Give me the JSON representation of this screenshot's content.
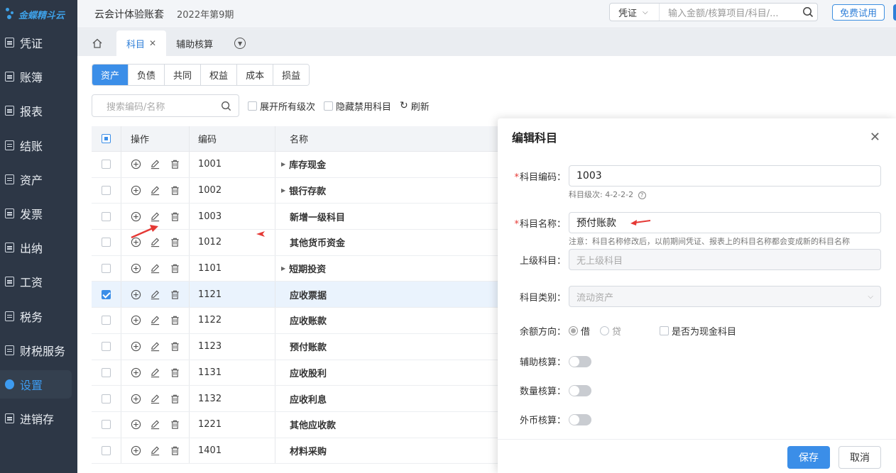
{
  "brand": {
    "name": "金蝶精斗云"
  },
  "sidebar": {
    "items": [
      {
        "label": "凭证",
        "icon": "voucher-icon"
      },
      {
        "label": "账簿",
        "icon": "ledger-icon"
      },
      {
        "label": "报表",
        "icon": "report-icon"
      },
      {
        "label": "结账",
        "icon": "closing-icon"
      },
      {
        "label": "资产",
        "icon": "asset-icon"
      },
      {
        "label": "发票",
        "icon": "invoice-icon"
      },
      {
        "label": "出纳",
        "icon": "cashier-icon"
      },
      {
        "label": "工资",
        "icon": "salary-icon"
      },
      {
        "label": "税务",
        "icon": "tax-icon"
      },
      {
        "label": "财税服务",
        "icon": "service-icon"
      },
      {
        "label": "设置",
        "icon": "settings-icon",
        "active": true
      },
      {
        "label": "进销存",
        "icon": "inventory-icon"
      }
    ]
  },
  "topbar": {
    "book": "云会计体验账套",
    "period": "2022年第9期",
    "search_type": "凭证",
    "search_placeholder": "输入金额/核算项目/科目/...",
    "trial_label": "免费试用"
  },
  "tabs": [
    {
      "label": "科目",
      "active": true,
      "closable": true
    },
    {
      "label": "辅助核算",
      "active": false
    }
  ],
  "categories": [
    "资产",
    "负债",
    "共同",
    "权益",
    "成本",
    "损益"
  ],
  "filters": {
    "search_placeholder": "搜索编码/名称",
    "expand_all": "展开所有级次",
    "hide_disabled": "隐藏禁用科目",
    "refresh": "刷新"
  },
  "table": {
    "headers": {
      "op": "操作",
      "code": "编码",
      "name": "名称"
    },
    "rows": [
      {
        "code": "1001",
        "name": "库存现金",
        "expandable": true
      },
      {
        "code": "1002",
        "name": "银行存款",
        "expandable": true
      },
      {
        "code": "1003",
        "name": "新增一级科目",
        "expandable": false
      },
      {
        "code": "1012",
        "name": "其他货币资金",
        "expandable": false
      },
      {
        "code": "1101",
        "name": "短期投资",
        "expandable": true
      },
      {
        "code": "1121",
        "name": "应收票据",
        "expandable": false,
        "selected": true
      },
      {
        "code": "1122",
        "name": "应收账款",
        "expandable": false
      },
      {
        "code": "1123",
        "name": "预付账款",
        "expandable": false
      },
      {
        "code": "1131",
        "name": "应收股利",
        "expandable": false
      },
      {
        "code": "1132",
        "name": "应收利息",
        "expandable": false
      },
      {
        "code": "1221",
        "name": "其他应收款",
        "expandable": false
      },
      {
        "code": "1401",
        "name": "材料采购",
        "expandable": false
      }
    ]
  },
  "dialog": {
    "title": "编辑科目",
    "code_label": "科目编码：",
    "code_value": "1003",
    "code_hint": "科目级次: 4-2-2-2",
    "name_label": "科目名称：",
    "name_value": "预付账款",
    "name_hint": "注意：科目名称修改后，以前期间凭证、报表上的科目名称都会变成新的科目名称",
    "parent_label": "上级科目：",
    "parent_placeholder": "无上级科目",
    "type_label": "科目类别：",
    "type_value": "流动资产",
    "direction_label": "余额方向：",
    "debit": "借",
    "credit": "贷",
    "direction_selected": "借",
    "cash_label": "是否为现金科目",
    "aux_label": "辅助核算：",
    "qty_label": "数量核算：",
    "fx_label": "外币核算：",
    "save": "保存",
    "cancel": "取消"
  },
  "colors": {
    "accent": "#3b8ee8",
    "sidebar_bg": "#2d3746",
    "annotation": "#e53935"
  }
}
